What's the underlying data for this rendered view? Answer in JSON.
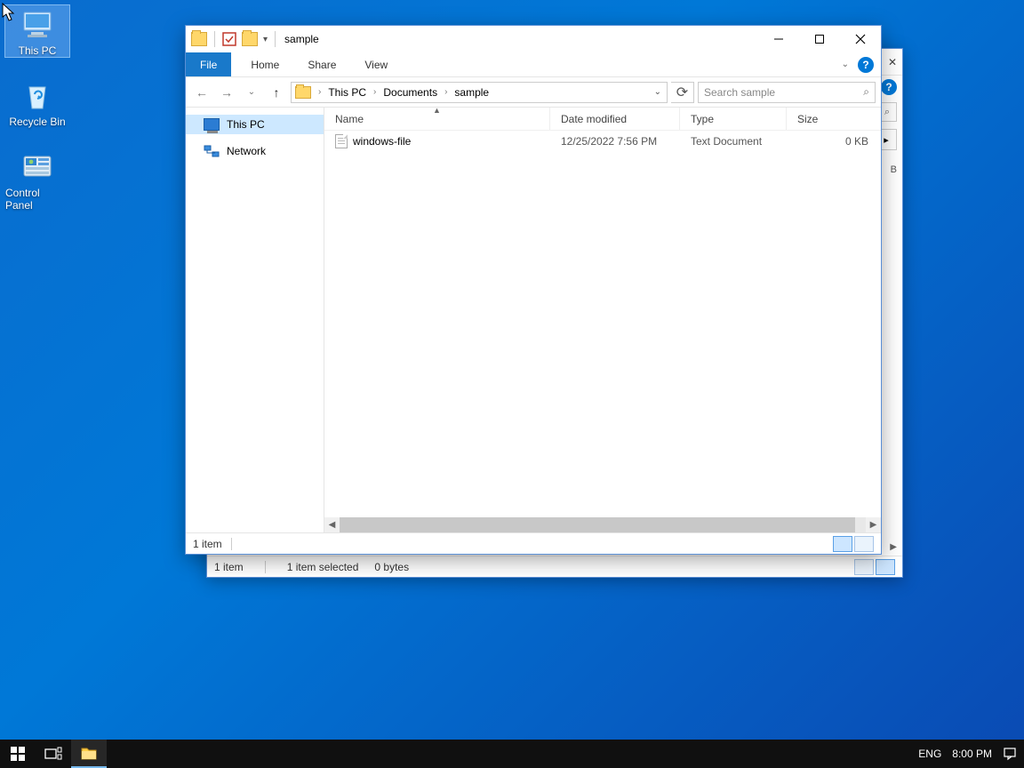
{
  "desktop": {
    "icons": [
      {
        "label": "This PC",
        "kind": "pc",
        "selected": true
      },
      {
        "label": "Recycle Bin",
        "kind": "recycle",
        "selected": false
      },
      {
        "label": "Control Panel",
        "kind": "control",
        "selected": false
      }
    ]
  },
  "back_window": {
    "status_items": "1 item",
    "status_selected": "1 item selected",
    "status_bytes": "0 bytes"
  },
  "window": {
    "title": "sample",
    "tabs": {
      "file": "File",
      "home": "Home",
      "share": "Share",
      "view": "View"
    },
    "breadcrumb": [
      "This PC",
      "Documents",
      "sample"
    ],
    "search_placeholder": "Search sample",
    "nav": [
      {
        "label": "This PC",
        "kind": "pc",
        "selected": true
      },
      {
        "label": "Network",
        "kind": "network",
        "selected": false
      }
    ],
    "columns": {
      "name": "Name",
      "date": "Date modified",
      "type": "Type",
      "size": "Size"
    },
    "files": [
      {
        "name": "windows-file",
        "date": "12/25/2022 7:56 PM",
        "type": "Text Document",
        "size": "0 KB"
      }
    ],
    "status": "1 item"
  },
  "taskbar": {
    "lang": "ENG",
    "time": "8:00 PM"
  }
}
